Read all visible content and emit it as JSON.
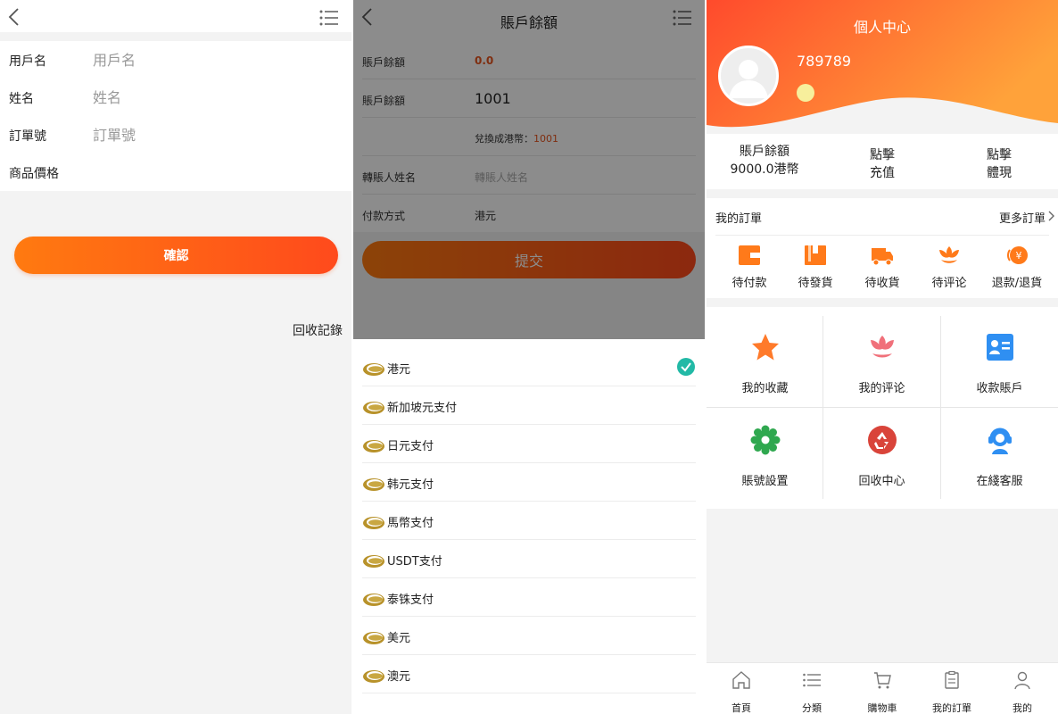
{
  "panel1": {
    "form": {
      "username_label": "用戶名",
      "username_placeholder": "用戶名",
      "name_label": "姓名",
      "name_placeholder": "姓名",
      "order_label": "訂單號",
      "order_placeholder": "訂單號",
      "price_label": "商品價格"
    },
    "confirm_label": "確認",
    "recycle_link": "回收記錄",
    "icons": {
      "back": "chevron-left-icon",
      "menu": "list-menu-icon"
    }
  },
  "panel2": {
    "title": "賬戶餘額",
    "rows": {
      "balance_label": "賬戶餘額",
      "balance_value": "0.0",
      "amount_label": "賬戶餘額",
      "amount_value": "1001",
      "convert_label": "兌換成港幣：",
      "convert_value": "1001",
      "transfer_label": "轉賬人姓名",
      "transfer_placeholder": "轉賬人姓名",
      "method_label": "付款方式",
      "method_value": "港元"
    },
    "submit_label": "提交",
    "payment_options": [
      "港元",
      "新加坡元支付",
      "日元支付",
      "韩元支付",
      "馬幣支付",
      "USDT支付",
      "泰铢支付",
      "美元",
      "澳元"
    ],
    "selected_option": "港元",
    "colors": {
      "accent": "#ff5a1c",
      "check": "#22b9a6",
      "balance_red": "#e8541e"
    }
  },
  "panel3": {
    "title": "個人中心",
    "username": "789789",
    "stats": {
      "balance_label": "賬戶餘額",
      "balance_value": "9000.0港幣",
      "recharge_line1": "點擊",
      "recharge_line2": "充值",
      "withdraw_line1": "點擊",
      "withdraw_line2": "體現"
    },
    "orders": {
      "title": "我的訂單",
      "more": "更多訂單",
      "items": [
        "待付款",
        "待發貨",
        "待收貨",
        "待评论",
        "退款/退貨"
      ]
    },
    "grid": [
      "我的收藏",
      "我的评论",
      "收款賬戶",
      "賬號設置",
      "回收中心",
      "在綫客服"
    ],
    "tabs": [
      "首頁",
      "分類",
      "購物車",
      "我的訂單",
      "我的"
    ],
    "colors": {
      "hero_start": "#ff4a2c",
      "hero_end": "#ffa23a"
    }
  }
}
